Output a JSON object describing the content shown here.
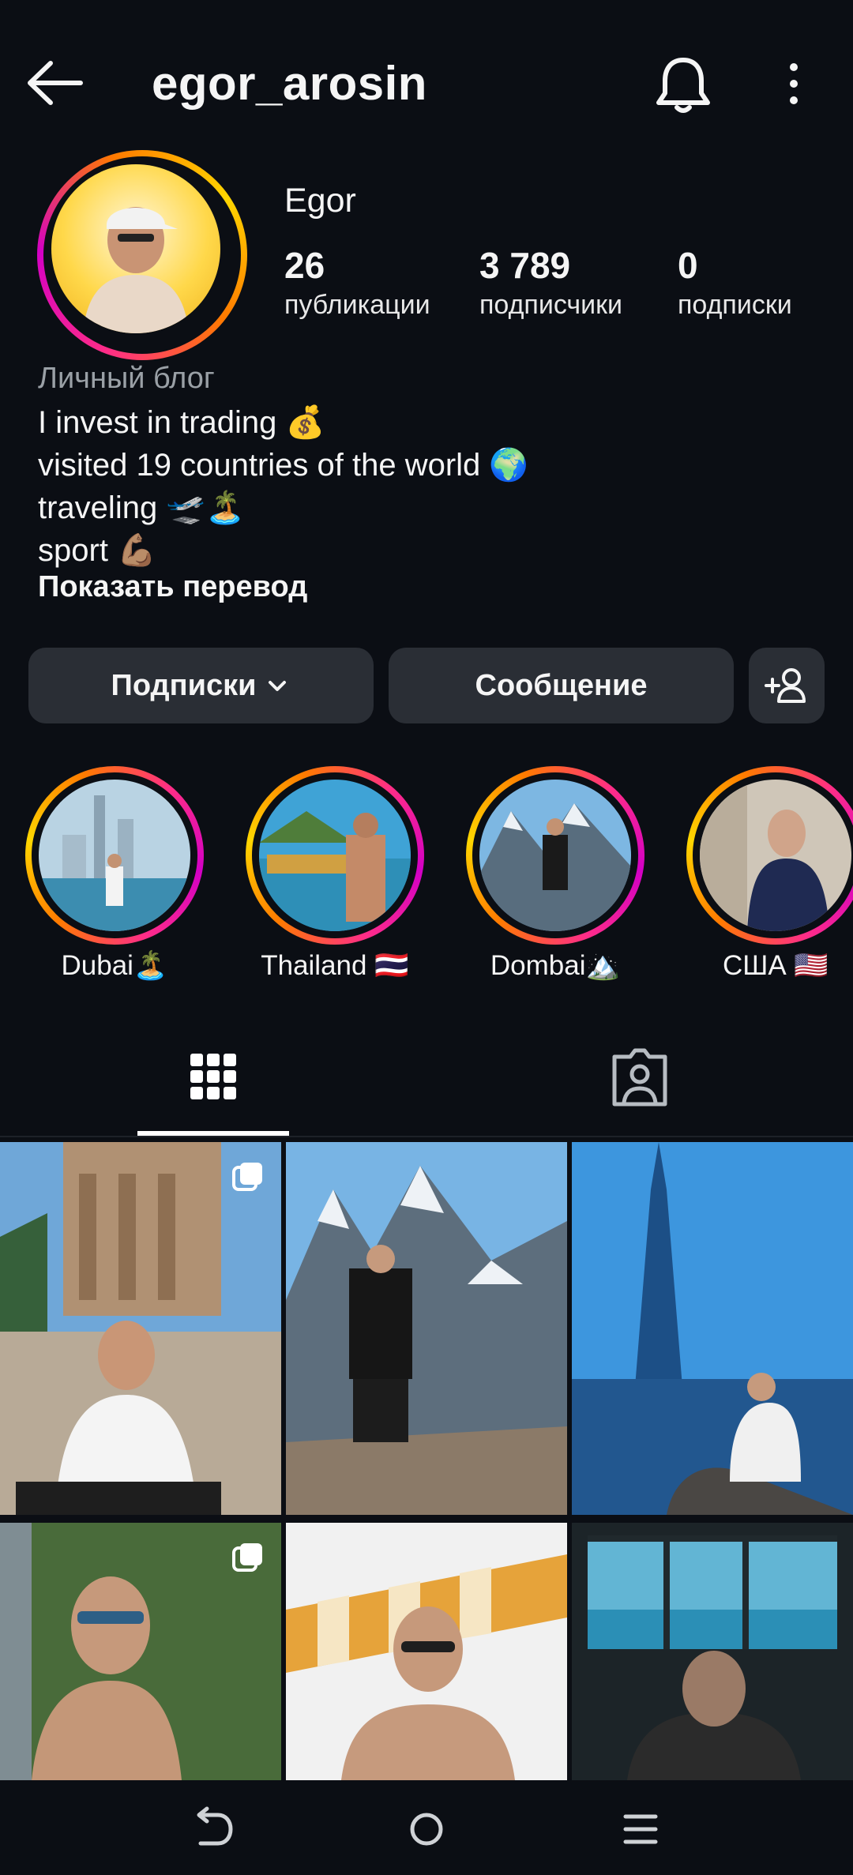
{
  "header": {
    "username": "egor_arosin",
    "back_icon": "arrow-left-icon",
    "bell_icon": "bell-icon",
    "more_icon": "more-vertical-icon"
  },
  "profile": {
    "display_name": "Egor",
    "stats": [
      {
        "value": "26",
        "label": "публикации"
      },
      {
        "value": "3 789",
        "label": "подписчики"
      },
      {
        "value": "0",
        "label": "подписки"
      }
    ],
    "category": "Личный блог",
    "bio": [
      "I invest in trading 💰",
      "visited 19 countries of the world 🌍",
      "traveling 🛫🏝️",
      "sport 💪🏽"
    ],
    "translate_label": "Показать перевод"
  },
  "actions": {
    "following_label": "Подписки",
    "message_label": "Сообщение",
    "add_friend_icon": "person-add-icon"
  },
  "highlights": [
    {
      "label": "Dubai🏝️"
    },
    {
      "label": "Thailand 🇹🇭"
    },
    {
      "label": "Dombai🏔️"
    },
    {
      "label": "США 🇺🇸"
    }
  ],
  "tabs": {
    "grid_icon": "grid-icon",
    "tagged_icon": "tagged-person-icon",
    "active": "grid"
  },
  "colors": {
    "background": "#0b0e14",
    "button": "#2a2e35",
    "ring_start": "#ffd600",
    "ring_end": "#d300c5"
  }
}
